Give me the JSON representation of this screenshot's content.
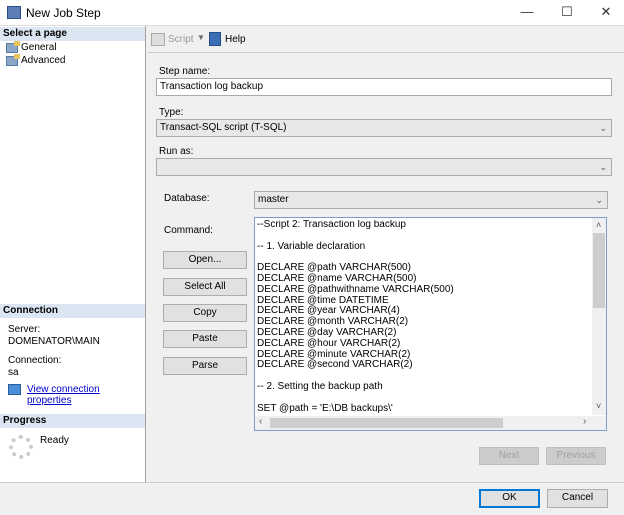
{
  "window": {
    "title": "New Job Step",
    "minimize": "—",
    "maximize": "☐",
    "close": "✕"
  },
  "sidebar": {
    "select_page": "Select a page",
    "pages": [
      {
        "label": "General"
      },
      {
        "label": "Advanced"
      }
    ],
    "connection": {
      "header": "Connection",
      "server_label": "Server:",
      "server": "DOMENATOR\\MAIN",
      "connection_label": "Connection:",
      "connection": "sa",
      "link": "View connection properties"
    },
    "progress": {
      "header": "Progress",
      "status": "Ready"
    }
  },
  "toolbar": {
    "script": "Script",
    "help": "Help"
  },
  "form": {
    "step_name_label": "Step name:",
    "step_name": "Transaction log backup",
    "type_label": "Type:",
    "type": "Transact-SQL script (T-SQL)",
    "run_as_label": "Run as:",
    "run_as": "",
    "database_label": "Database:",
    "database": "master",
    "command_label": "Command:",
    "command": "--Script 2: Transaction log backup\n\n-- 1. Variable declaration\n\nDECLARE @path VARCHAR(500)\nDECLARE @name VARCHAR(500)\nDECLARE @pathwithname VARCHAR(500)\nDECLARE @time DATETIME\nDECLARE @year VARCHAR(4)\nDECLARE @month VARCHAR(2)\nDECLARE @day VARCHAR(2)\nDECLARE @hour VARCHAR(2)\nDECLARE @minute VARCHAR(2)\nDECLARE @second VARCHAR(2)\n\n-- 2. Setting the backup path\n\nSET @path = 'E:\\DB backups\\'"
  },
  "buttons": {
    "open": "Open...",
    "select_all": "Select All",
    "copy": "Copy",
    "paste": "Paste",
    "parse": "Parse",
    "next": "Next",
    "previous": "Previous",
    "ok": "OK",
    "cancel": "Cancel"
  }
}
